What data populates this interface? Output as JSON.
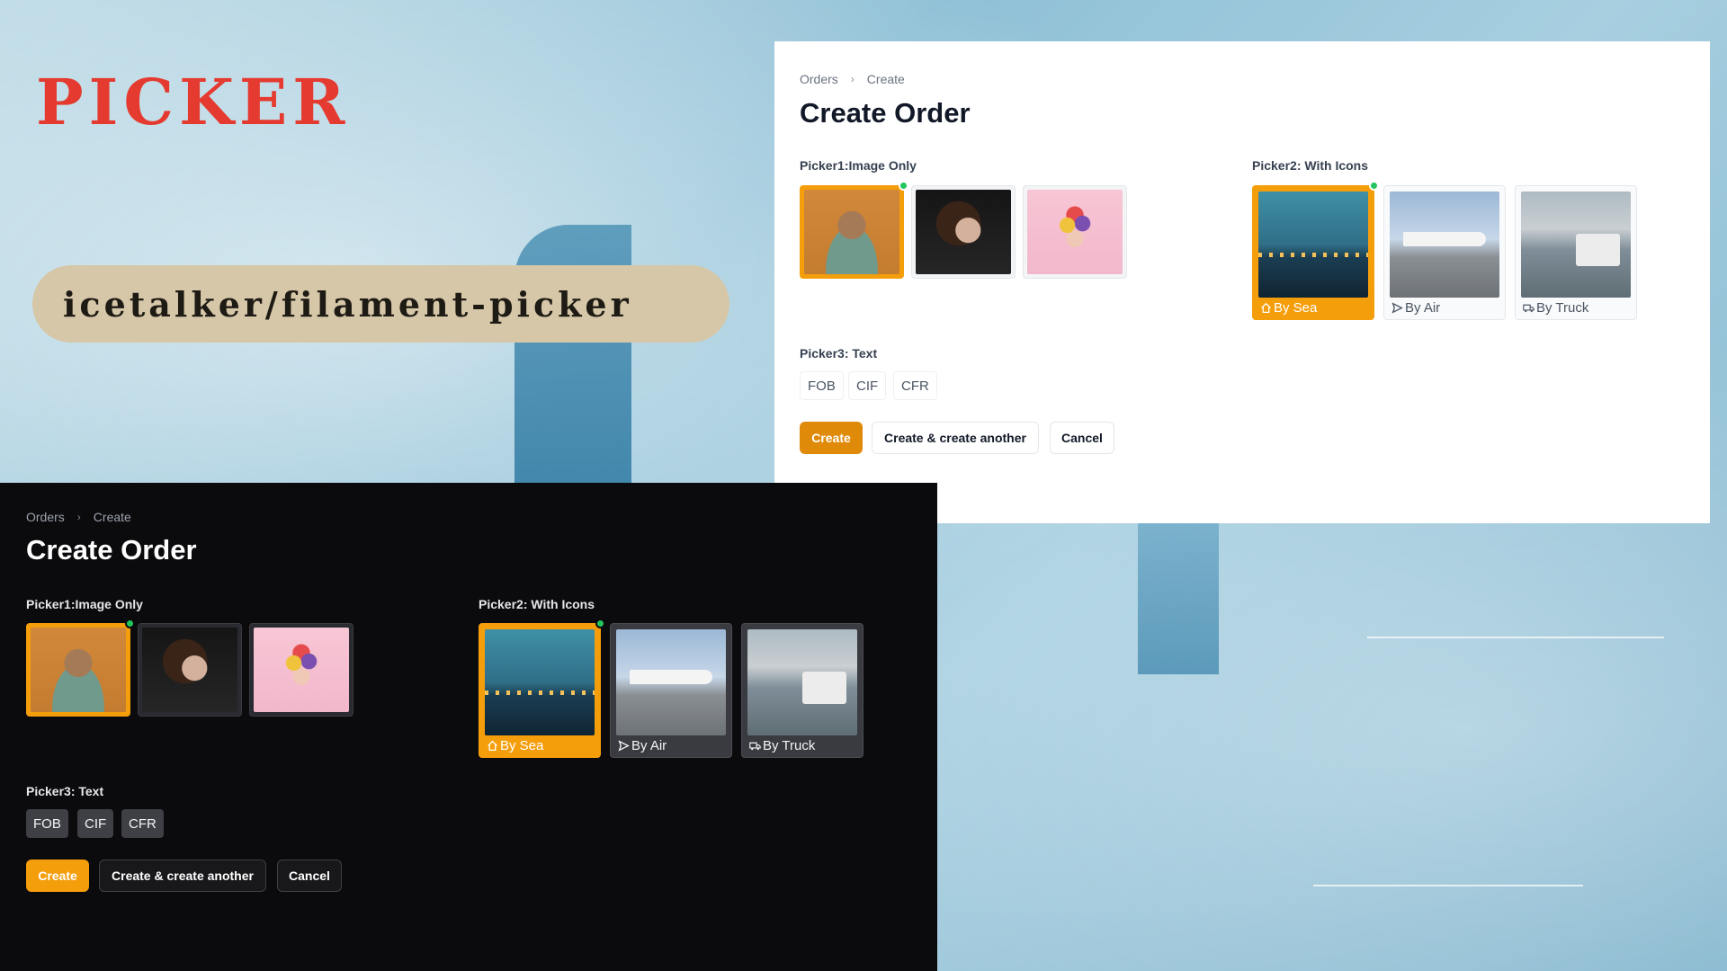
{
  "brand": {
    "title": "PICKER",
    "package": "icetalker/filament-picker"
  },
  "panels": {
    "light": {
      "breadcrumbs": [
        "Orders",
        "Create"
      ],
      "title": "Create Order",
      "picker1": {
        "label": "Picker1:Image Only",
        "selected_index": 0
      },
      "picker2": {
        "label": "Picker2: With Icons",
        "options": [
          "By Sea",
          "By Air",
          "By Truck"
        ],
        "selected_index": 0
      },
      "picker3": {
        "label": "Picker3: Text",
        "options": [
          "FOB",
          "CIF",
          "CFR"
        ]
      },
      "buttons": {
        "create": "Create",
        "create_another": "Create & create another",
        "cancel": "Cancel"
      }
    },
    "dark": {
      "breadcrumbs": [
        "Orders",
        "Create"
      ],
      "title": "Create Order",
      "picker1": {
        "label": "Picker1:Image Only",
        "selected_index": 0
      },
      "picker2": {
        "label": "Picker2: With Icons",
        "options": [
          "By Sea",
          "By Air",
          "By Truck"
        ],
        "selected_index": 0
      },
      "picker3": {
        "label": "Picker3: Text",
        "options": [
          "FOB",
          "CIF",
          "CFR"
        ]
      },
      "buttons": {
        "create": "Create",
        "create_another": "Create & create another",
        "cancel": "Cancel"
      }
    }
  },
  "icons": [
    "home-icon",
    "paper-plane-icon",
    "truck-icon",
    "check-icon"
  ],
  "colors": {
    "brand": "#e53a2f",
    "primary": "#f59e0b",
    "selected_check": "#22c55e",
    "pill": "#d6c7a8"
  }
}
